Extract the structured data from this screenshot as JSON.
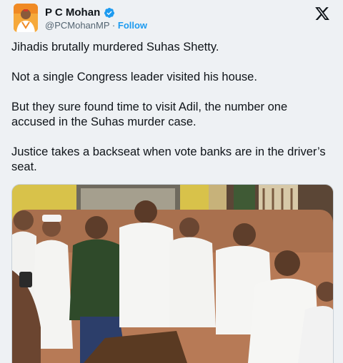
{
  "author": {
    "display_name": "P C Mohan",
    "handle": "@PCMohanMP",
    "separator": "·",
    "follow_label": "Follow",
    "verified": true,
    "verified_color": "#1d9bf0"
  },
  "tweet": {
    "paragraphs": [
      "Jihadis brutally murdered Suhas Shetty.",
      "Not a single Congress leader visited his house.",
      "But they sure found time to visit Adil, the number one accused in the Suhas murder case.",
      "Justice takes a backseat when vote banks are in the driver’s seat."
    ]
  },
  "media": {
    "type": "photo",
    "content": "group of men seated on a sofa indoors"
  },
  "icons": {
    "platform": "x-logo-icon",
    "badge": "verified-badge-icon"
  },
  "colors": {
    "accent": "#1d9bf0",
    "text": "#0f1419",
    "secondary_text": "#536471",
    "background": "#eef1f4"
  }
}
